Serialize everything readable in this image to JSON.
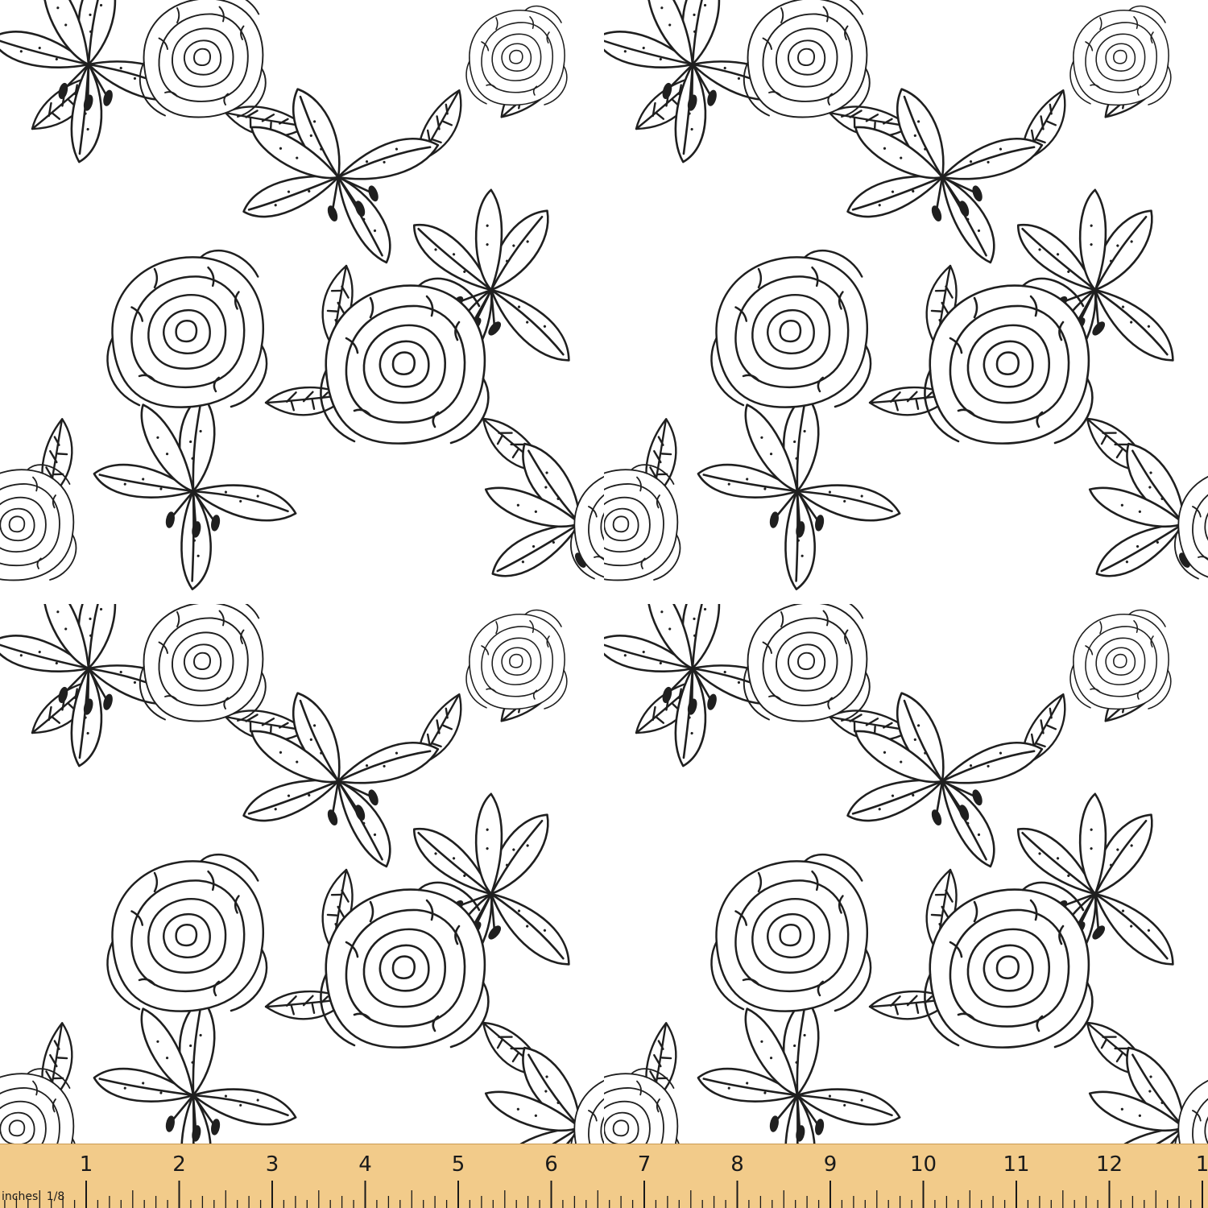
{
  "pattern": {
    "motifs": [
      "rose",
      "lily",
      "leaf"
    ],
    "line_color": "#1f1f1f",
    "background_color": "#ffffff",
    "style": "hand-drawn black outline floral on white fabric"
  },
  "ruler": {
    "unit_label": "inches",
    "fraction_label": "1/8",
    "numbers": [
      "1",
      "2",
      "3",
      "4",
      "5",
      "6",
      "7",
      "8",
      "9",
      "10",
      "11",
      "12",
      "1"
    ],
    "color": "#f2cb8a",
    "mark_color": "#1a1a1a"
  }
}
